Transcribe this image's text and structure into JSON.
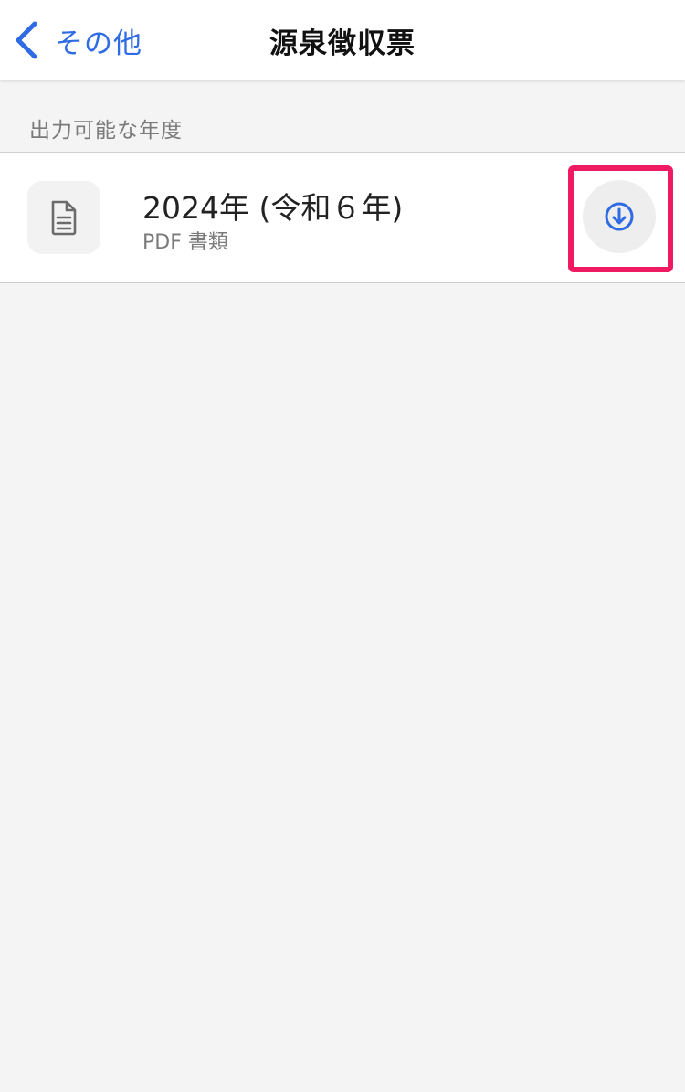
{
  "nav": {
    "back_label": "その他",
    "title": "源泉徴収票"
  },
  "section": {
    "header": "出力可能な年度"
  },
  "items": [
    {
      "title": "2024年 (令和６年)",
      "subtitle": "PDF 書類",
      "icon": "document-icon",
      "action_icon": "download-icon"
    }
  ],
  "colors": {
    "accent": "#2f6be3",
    "highlight": "#ef1a62",
    "background": "#f5f4f5"
  }
}
